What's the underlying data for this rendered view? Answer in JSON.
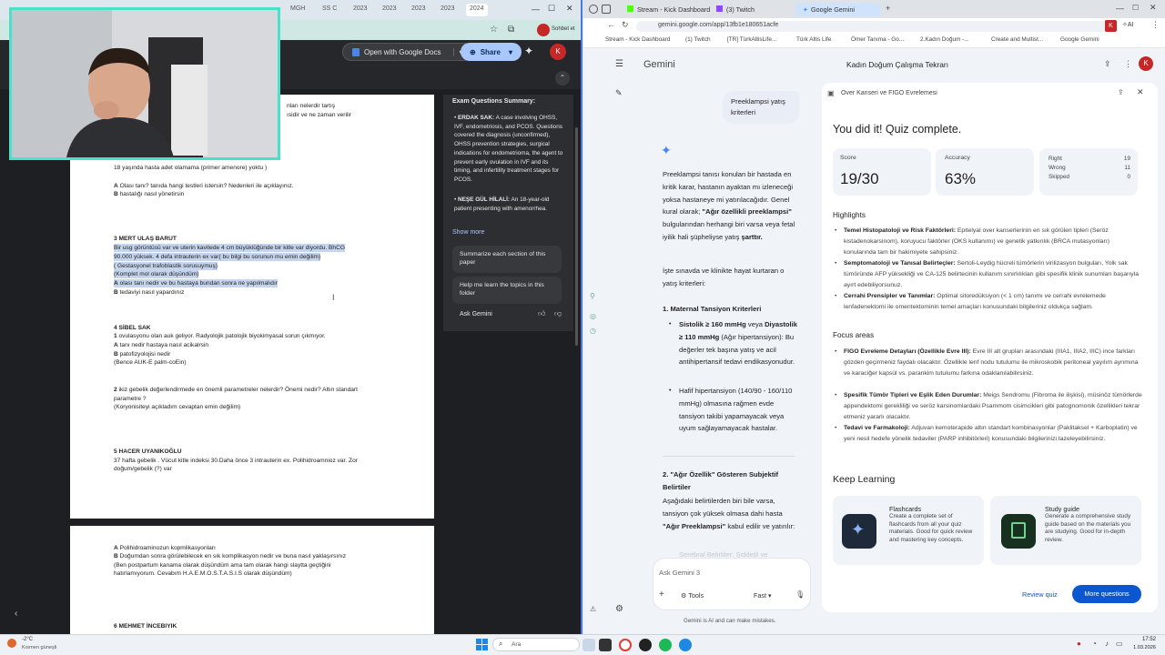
{
  "left_browser": {
    "tabs": [
      "MGH",
      "SS C",
      "2023",
      "2023",
      "2023",
      "2023",
      "2024"
    ],
    "profile_hint": "Sohbet et",
    "open_with_label": "Open with Google Docs",
    "share_label": "Share",
    "avatar_letter": "K",
    "summary": {
      "title": "Exam Questions Summary:",
      "bullet1_name": "ERDAK SAK:",
      "bullet1_text": "A case involving OHSS, IVF, endometriosis, and PCOS. Questions covered the diagnosis (unconfirmed), OHSS prevention strategies, surgical indications for endometrioma, the agent to prevent early ovulation in IVF and its timing, and infertility treatment stages for PCOS.",
      "bullet2_name": "NEŞE GÜL HİLALİ:",
      "bullet2_text": "An 18-year-old patient presenting with amenorrhea.",
      "show_more": "Show more",
      "suggestion1": "Summarize each section of this paper",
      "suggestion2": "Help me learn the topics in this folder",
      "ask_label": "Ask Gemini"
    },
    "document": {
      "l01": "nları nelerdir tartış",
      "l02": "ısidir ve ne zaman verilir",
      "l03": "18 yaşında hasta adet olamama (primer amenore) yoktu )",
      "l04a": "A",
      "l04": " Olası tanı? tanıda hangi testleri istersin? Nedenleri ile açıklayınız.",
      "l05a": "B",
      "l05": " hastalığı nasıl yönetirsin",
      "l06": "3 MERT ULAŞ BARUT",
      "l07": "Bir usg görüntüsü var ve uterin kavitede 4 cm büyüklüğünde bir kitle var diyordu. BhCG",
      "l08": "90.000 yüksek. 4 defa intrauterin ex var( bu bilgi bu sorunun mu emin değilim)",
      "l09": "( Gestasyonel trafoblastik sorusuymuş)",
      "l10": "(Komplet mol olarak düşündüm)",
      "l11a": "A",
      "l11": " olası tanı nedir ve bu hastaya bundan sonra ne yapılmalıdır",
      "l12a": "B",
      "l12": " tedaviyi nasıl yapardınız",
      "l13": "4 SİBEL SAK",
      "l14a": "1",
      "l14": " ovulasyonu olan auk geliyor. Radyolojik patolojik biyokimyasal sorun çıkmıyor.",
      "l15a": "A",
      "l15": " tanı nedir hastaya nasıl acikalrsin",
      "l16a": "B",
      "l16": " patofizyolojisi nedir",
      "l17": "(Bence AUK-E  palm-coEin)",
      "l18a": "2",
      "l18": " ikiz gebelik değerlendirmede en önemli parametreler nelerdir? Önemi nedir? Altın standart",
      "l19": "parametre ?",
      "l20": "(Koryonisiteyi açıkladım cevaptan emin değilim)",
      "l21": "5 HACER UYANIKOĞLU",
      "l22": "37 hafta gebelik . Vücut kitle indeksi 30.Daha önce 3 intrauterin ex. Polihidroamnioz var. Zor",
      "l23": "doğum/gebelik (?) var",
      "p2_l1a": "A",
      "p2_l1": " Polihidroaminozun kopmlikasyonları",
      "p2_l2a": "B",
      "p2_l2": " Doğumdan sonra görülebilecek en sık komplikasyon nedir ve buna nasıl yaklaşırsınız",
      "p2_l3": "(Ben postpartum kanama olarak düşündüm ama tam olarak hangi slaytta geçtiğini",
      "p2_l4": "hatırlamıyorum. Cevabım H.A.E.M.O.S.T.A.S.I.S olarak düşündüm)",
      "p2_l5": "6 MEHMET İNCEBIYIK"
    }
  },
  "right_browser": {
    "tabs": [
      "Stream - Kick Dashboard",
      "(3) Twitch",
      "Google Gemini"
    ],
    "url": "gemini.google.com/app/13fb1e180651acfe",
    "bookmarks": [
      "Stream - Kick Dashboard",
      "(1) Twitch",
      "[TR] TürkAltisLife...",
      "Türk Altis Life",
      "Ömer Tanıma - Go...",
      "2.Kadın Doğum -...",
      "Create and Multist...",
      "Google Gemini"
    ],
    "profile_letter": "K",
    "ai_label": "AI"
  },
  "gemini": {
    "brand": "Gemini",
    "conversation_title": "Kadın Doğum Çalışma Tekrarı",
    "user_message": "Preeklampsi yatış kriterleri",
    "response": {
      "intro_1": "Preeklampsi tanısı konulan bir hastada en kritik karar, hastanın ayaktan mı izleneceği yoksa hastaneye mi yatırılacağıdır. Genel kural olarak; ",
      "intro_bold": "\"Ağır özellikli preeklampsi\"",
      "intro_2": " bulgularından herhangi biri varsa veya fetal iyilik hali şüpheliyse yatış ",
      "intro_bold2": "şarttır.",
      "intro_3": "İşte sınavda ve klinikte hayat kurtaran o yatış kriterleri:",
      "h1": "1. Maternal Tansiyon Kriterleri",
      "b1_1": "Sistolik ≥ 160 mmHg",
      "b1_2": " veya ",
      "b1_3": "Diyastolik ≥ 110 mmHg",
      "b1_4": " (Ağır hipertansiyon): Bu değerler tek başına yatış ve acil antihipertansif tedavi endikasyonudur.",
      "b2": "Hafif hipertansiyon (140/90 - 160/110 mmHg) olmasına rağmen evde tansiyon takibi yapamayacak veya uyum sağlayamayacak hastalar.",
      "h2": "2. \"Ağır Özellik\" Gösteren Subjektif Belirtiler",
      "p2_1": "Aşağıdaki belirtilerden biri bile varsa, tansiyon çok yüksek olmasa dahi hasta ",
      "p2_bold": "\"Ağır Preeklampsi\"",
      "p2_2": " kabul edilir ve yatırılır:",
      "faded": "Serebral Belirtiler: Şiddetli ve geçmeyen"
    },
    "input_placeholder": "Ask Gemini 3",
    "tools_label": "Tools",
    "mode_label": "Fast",
    "disclaimer": "Gemini is AI and can make mistakes."
  },
  "quiz_panel": {
    "header": "Over Kanseri ve FIGO Evrelemesi",
    "title": "You did it! Quiz complete.",
    "score_label": "Score",
    "score_value": "19/30",
    "accuracy_label": "Accuracy",
    "accuracy_value": "63%",
    "right_label": "Right",
    "right_value": "19",
    "wrong_label": "Wrong",
    "wrong_value": "11",
    "skipped_label": "Skipped",
    "skipped_value": "0",
    "highlights_title": "Highlights",
    "highlights": [
      {
        "name": "Temel Histopatoloji ve Risk Faktörleri:",
        "text": " Epitelyal over kanserlerinin en sık görülen tipleri (Seröz kistadenokarsinom), koruyucu faktörler (OKS kullanımı) ve genetik yatkınlık (BRCA mutasyonları) konularında tam bir hakimiyete sahipsiniz."
      },
      {
        "name": "Semptomatoloji ve Tanısal Belirteçler:",
        "text": " Sertoli-Leydig hücreli tümörlerin virilizasyon bulguları, Yolk sak tümöründe AFP yüksekliği ve CA-125 belirtecinin kullanım sınırlılıkları gibi spesifik klinik sunumları başarıyla ayırt edebiliyorsunuz."
      },
      {
        "name": "Cerrahi Prensipler ve Tanımlar:",
        "text": " Optimal sitoredüksiyon (< 1 cm) tanımı ve cerrahi evrelemede lenfadenektomi ile omentektominin temel amaçları konusundaki bilgileriniz oldukça sağlam."
      }
    ],
    "focus_title": "Focus areas",
    "focus": [
      {
        "name": "FIGO Evreleme Detayları (Özellikle Evre III):",
        "text": " Evre III alt grupları arasındaki (IIIA1, IIIA2, IIIC) ince farkları gözden geçirmeniz faydalı olacaktır. Özellikle lenf nodu tutulumu ile mikroskobik peritoneal yayılım ayrımına ve karaciğer kapsül vs. parankim tutulumu farkına odaklanılabilirsiniz."
      },
      {
        "name": "Spesifik Tümör Tipleri ve Eşlik Eden Durumlar:",
        "text": " Meigs Sendromu (Fibroma ile ilişkisi), müsinöz tümörlerde appendektomi gerekliliği ve seröz karsinomlardaki Psammom cisimcikleri gibi patognomonik özellikleri tekrar etmeniz yararlı olacaktır."
      },
      {
        "name": "Tedavi ve Farmakoloji:",
        "text": " Adjuvan kemoterapide altın standart kombinasyonlar (Paklitaksel + Karboplatin) ve yeni nesil hedefe yönelik tedaviler (PARP inhibitörleri) konusundaki bilgilerinizi tazeleyebilirsiniz."
      }
    ],
    "keep_learning_title": "Keep Learning",
    "flashcards_title": "Flashcards",
    "flashcards_text": "Create a complete set of flashcards from all your quiz materials. Good for quick review and mastering key concepts.",
    "study_guide_title": "Study guide",
    "study_guide_text": "Generate a comprehensive study guide based on the materials you are studying. Good for in-depth review.",
    "review_quiz_label": "Review quiz",
    "more_questions_label": "More questions"
  },
  "taskbar": {
    "weather_temp": "-2°C",
    "weather_desc": "Kısmen güneşli",
    "search_placeholder": "Ara",
    "time": "17:52",
    "date": "1.03.2026"
  },
  "colors": {
    "gemini_blue": "#0b57d0",
    "accent_teal": "#4ae0c9"
  }
}
